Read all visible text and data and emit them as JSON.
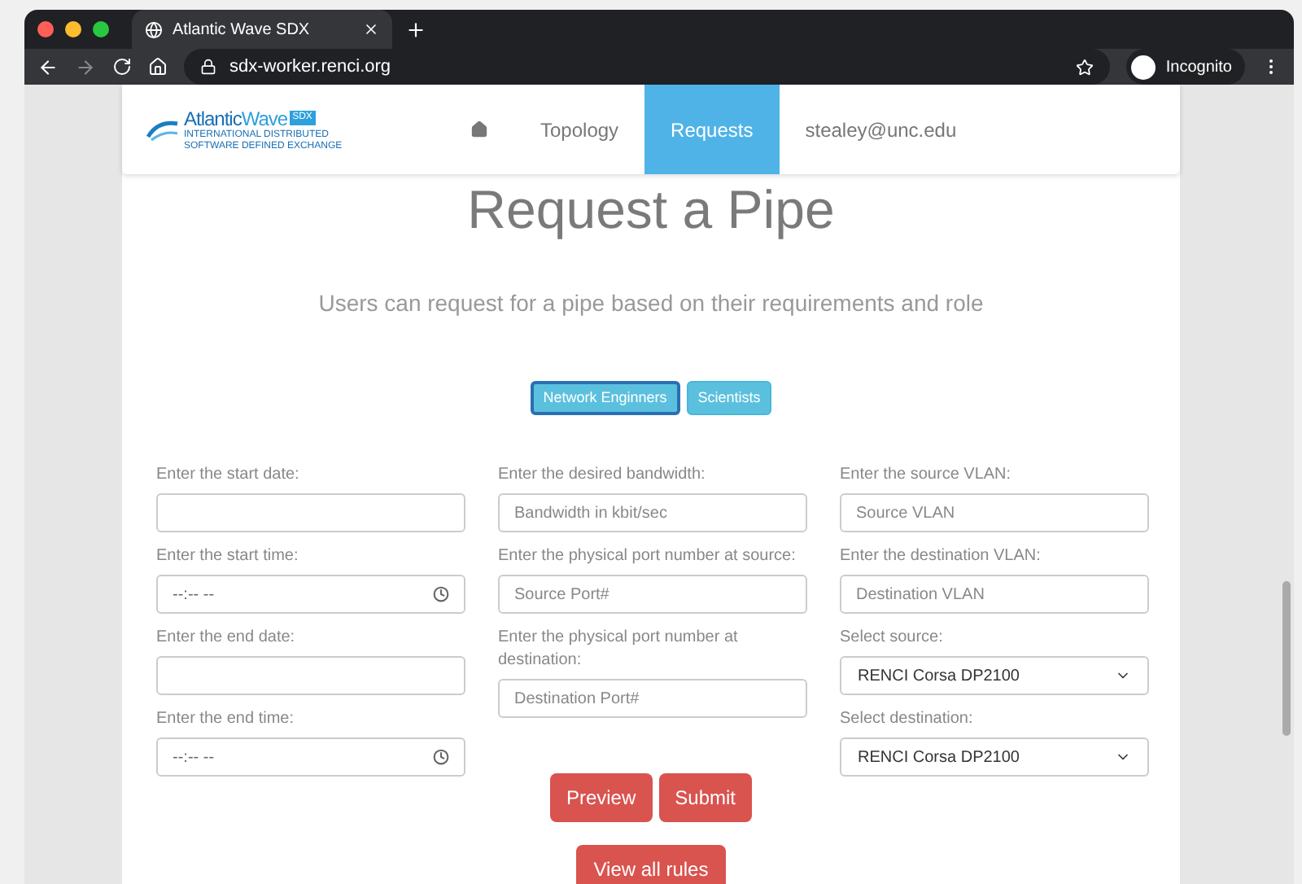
{
  "browser": {
    "tab_title": "Atlantic Wave SDX",
    "url": "sdx-worker.renci.org",
    "profile": "Incognito"
  },
  "logo": {
    "name_first": "Atlantic",
    "name_second": "Wave",
    "badge": "SDX",
    "tagline": "INTERNATIONAL DISTRIBUTED SOFTWARE DEFINED EXCHANGE"
  },
  "nav": [
    {
      "kind": "home",
      "selected": false
    },
    {
      "kind": "text",
      "label": "Topology",
      "selected": false
    },
    {
      "kind": "text",
      "label": "Requests",
      "selected": true
    },
    {
      "kind": "text",
      "label": "stealey@unc.edu",
      "selected": false
    }
  ],
  "title": "Request a Pipe",
  "subtitle": "Users can request for a pipe based on their requirements and role",
  "roles": [
    {
      "label": "Network Enginners",
      "selected": true
    },
    {
      "label": "Scientists",
      "selected": false
    }
  ],
  "form_columns": [
    [
      {
        "label": "Enter the start date:",
        "kind": "text"
      },
      {
        "label": "Enter the start time:",
        "kind": "time",
        "value": "--:-- --"
      },
      {
        "label": "Enter the end date:",
        "kind": "text"
      },
      {
        "label": "Enter the end time:",
        "kind": "time",
        "value": "--:-- --"
      }
    ],
    [
      {
        "label": "Enter the desired bandwidth:",
        "kind": "text",
        "placeholder": "Bandwidth in kbit/sec"
      },
      {
        "label": "Enter the physical port number at source:",
        "kind": "text",
        "placeholder": "Source Port#"
      },
      {
        "label": "Enter the physical port number at destination:",
        "kind": "text",
        "placeholder": "Destination Port#"
      }
    ],
    [
      {
        "label": "Enter the source VLAN:",
        "kind": "text",
        "placeholder": "Source VLAN"
      },
      {
        "label": "Enter the destination VLAN:",
        "kind": "text",
        "placeholder": "Destination VLAN"
      },
      {
        "label": "Select source:",
        "kind": "select",
        "value": "RENCI Corsa DP2100"
      },
      {
        "label": "Select destination:",
        "kind": "select",
        "value": "RENCI Corsa DP2100"
      }
    ]
  ],
  "actions": [
    "Preview",
    "Submit"
  ],
  "view_rules": "View all rules"
}
